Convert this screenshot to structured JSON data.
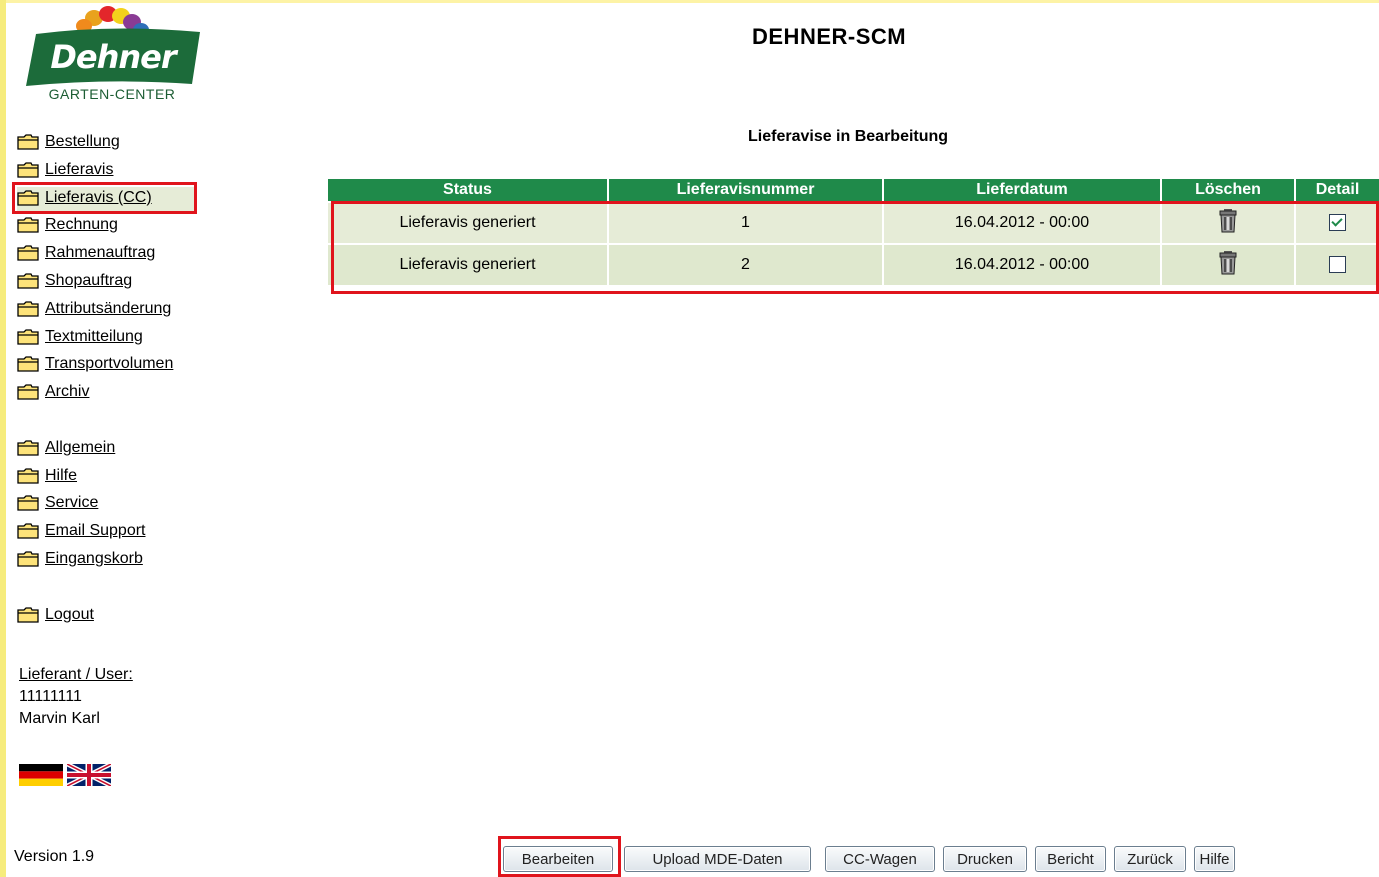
{
  "logo": {
    "brand": "Dehner",
    "sub": "GARTEN-CENTER"
  },
  "nav": {
    "group1": [
      {
        "label": "Bestellung"
      },
      {
        "label": "Lieferavis"
      },
      {
        "label": "Lieferavis (CC)"
      },
      {
        "label": "Rechnung"
      },
      {
        "label": "Rahmenauftrag"
      },
      {
        "label": "Shopauftrag"
      },
      {
        "label": "Attributsänderung"
      },
      {
        "label": "Textmitteilung"
      },
      {
        "label": "Transportvolumen"
      },
      {
        "label": "Archiv"
      }
    ],
    "group2": [
      {
        "label": "Allgemein"
      },
      {
        "label": "Hilfe"
      },
      {
        "label": "Service"
      },
      {
        "label": "Email Support"
      },
      {
        "label": "Eingangskorb"
      }
    ],
    "group3": [
      {
        "label": "Logout"
      }
    ]
  },
  "user": {
    "label": "Lieferant / User:",
    "id": "11111111",
    "name": "Marvin Karl"
  },
  "version": "Version 1.9",
  "app_title": "DEHNER-SCM",
  "section_title": "Lieferavise in Bearbeitung",
  "table": {
    "headers": [
      "Status",
      "Lieferavisnummer",
      "Lieferdatum",
      "Löschen",
      "Detail"
    ],
    "rows": [
      {
        "status": "Lieferavis generiert",
        "number": "1",
        "date": "16.04.2012 - 00:00",
        "detail_checked": true
      },
      {
        "status": "Lieferavis generiert",
        "number": "2",
        "date": "16.04.2012 - 00:00",
        "detail_checked": false
      }
    ]
  },
  "buttons": {
    "edit": "Bearbeiten",
    "upload": "Upload MDE-Daten",
    "cc": "CC-Wagen",
    "print": "Drucken",
    "report": "Bericht",
    "back": "Zurück",
    "help": "Hilfe"
  },
  "colors": {
    "header_green": "#1f8a4a",
    "highlight_red": "#e0141c",
    "row_bg": "#e6ecd7"
  }
}
